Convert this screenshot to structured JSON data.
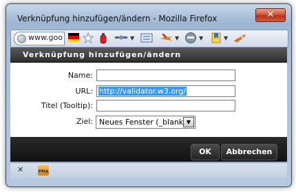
{
  "window": {
    "title": "Verknüpfung hinzufügen/ändern - Mozilla Firefox",
    "close_label": "✕"
  },
  "toolbar": {
    "address_text": "www.goo",
    "icons": [
      "globe-icon",
      "german-flag-icon",
      "bookmark-star-icon",
      "fire-extinguisher-icon",
      "satellite-icon",
      "calculator-icon",
      "airplane-icon",
      "ninja-icon",
      "chevron-down-icon",
      "bookmark-icon",
      "rocket-icon"
    ]
  },
  "dialog": {
    "title": "Verknüpfung hinzufügen/ändern",
    "fields": {
      "name_label": "Name:",
      "name_value": "",
      "url_label": "URL:",
      "url_value": "http://validator.w3.org/",
      "title_label": "Titel (Tooltip):",
      "title_value": "",
      "target_label": "Ziel:",
      "target_value": "Neues Fenster (_blank)"
    },
    "ok_label": "OK",
    "cancel_label": "Abbrechen"
  },
  "statusbar": {
    "close_label": "✕",
    "pma_label": "PMA"
  }
}
